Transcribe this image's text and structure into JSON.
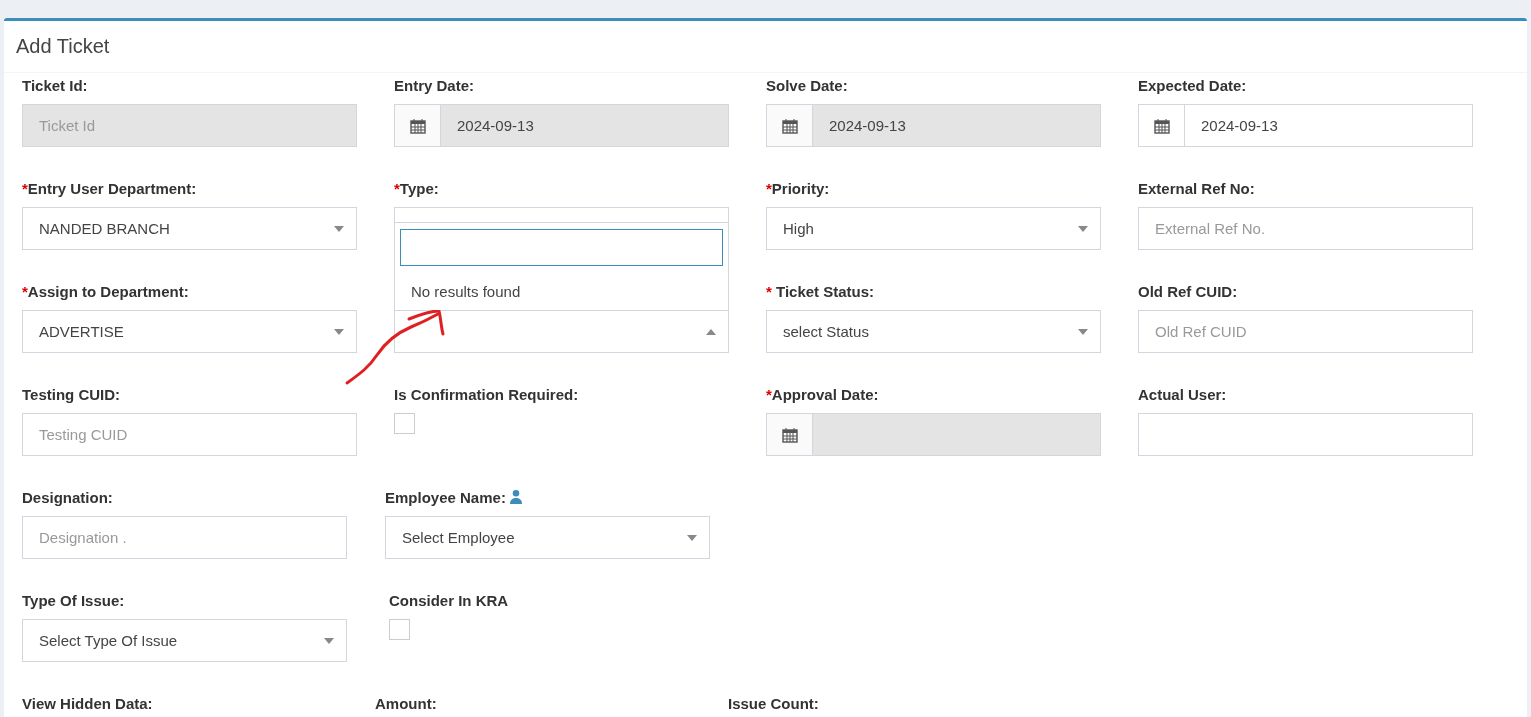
{
  "card": {
    "title": "Add Ticket"
  },
  "rows": [
    {
      "fields": [
        {
          "kind": "text",
          "label": "Ticket Id:",
          "placeholder": "Ticket Id",
          "disabled": true
        },
        {
          "kind": "date",
          "label": "Entry Date:",
          "value": "2024-09-13",
          "disabled": true
        },
        {
          "kind": "date",
          "label": "Solve Date:",
          "value": "2024-09-13",
          "disabled": true
        },
        {
          "kind": "date",
          "label": "Expected Date:",
          "value": "2024-09-13",
          "disabled": false
        }
      ]
    },
    {
      "fields": [
        {
          "kind": "select",
          "required_mark": "*",
          "label": "Entry User Department:",
          "value": "NANDED BRANCH",
          "open": false
        },
        {
          "kind": "select",
          "required_mark": "*",
          "label": "Type:",
          "open": false
        },
        {
          "kind": "select",
          "required_mark": "*",
          "label": "Priority:",
          "value": "High",
          "open": false
        },
        {
          "kind": "text",
          "label": "External Ref No:",
          "placeholder": "External Ref No.",
          "disabled": false
        }
      ]
    },
    {
      "fields": [
        {
          "kind": "select",
          "required_mark": "*",
          "label": "Assign to Department:",
          "value": "ADVERTISE",
          "open": false
        },
        {
          "kind": "select",
          "open": true,
          "dropdown": {
            "message": "No results found"
          }
        },
        {
          "kind": "select",
          "required_mark": "*",
          "label": " Ticket Status:",
          "value": "select Status",
          "open": false
        },
        {
          "kind": "text",
          "label": "Old Ref CUID:",
          "placeholder": "Old Ref CUID",
          "disabled": false
        }
      ]
    },
    {
      "fields": [
        {
          "kind": "text",
          "label": "Testing CUID:",
          "placeholder": "Testing CUID",
          "disabled": false
        },
        {
          "kind": "checkbox",
          "label": "Is Confirmation Required:",
          "checked": false
        },
        {
          "kind": "date",
          "required_mark": "*",
          "label": "Approval Date:",
          "disabled": true
        },
        {
          "kind": "text",
          "label": "Actual User:",
          "disabled": false
        }
      ]
    },
    {
      "fields": [
        {
          "kind": "text",
          "label": "Designation:",
          "placeholder": "Designation .",
          "disabled": false
        },
        {
          "kind": "person_select",
          "label": "Employee Name:",
          "value": "Select Employee",
          "open": false
        }
      ]
    },
    {
      "fields": [
        {
          "kind": "select",
          "label": "Type Of Issue:",
          "value": "Select Type Of Issue",
          "open": false
        },
        {
          "kind": "checkbox",
          "label": "Consider In KRA",
          "checked": false
        }
      ]
    },
    {
      "fields": [
        {
          "kind": "none",
          "label": "View Hidden Data:"
        },
        {
          "kind": "none",
          "label": "Amount:"
        },
        {
          "kind": "none",
          "label": "Issue Count:"
        }
      ]
    }
  ]
}
